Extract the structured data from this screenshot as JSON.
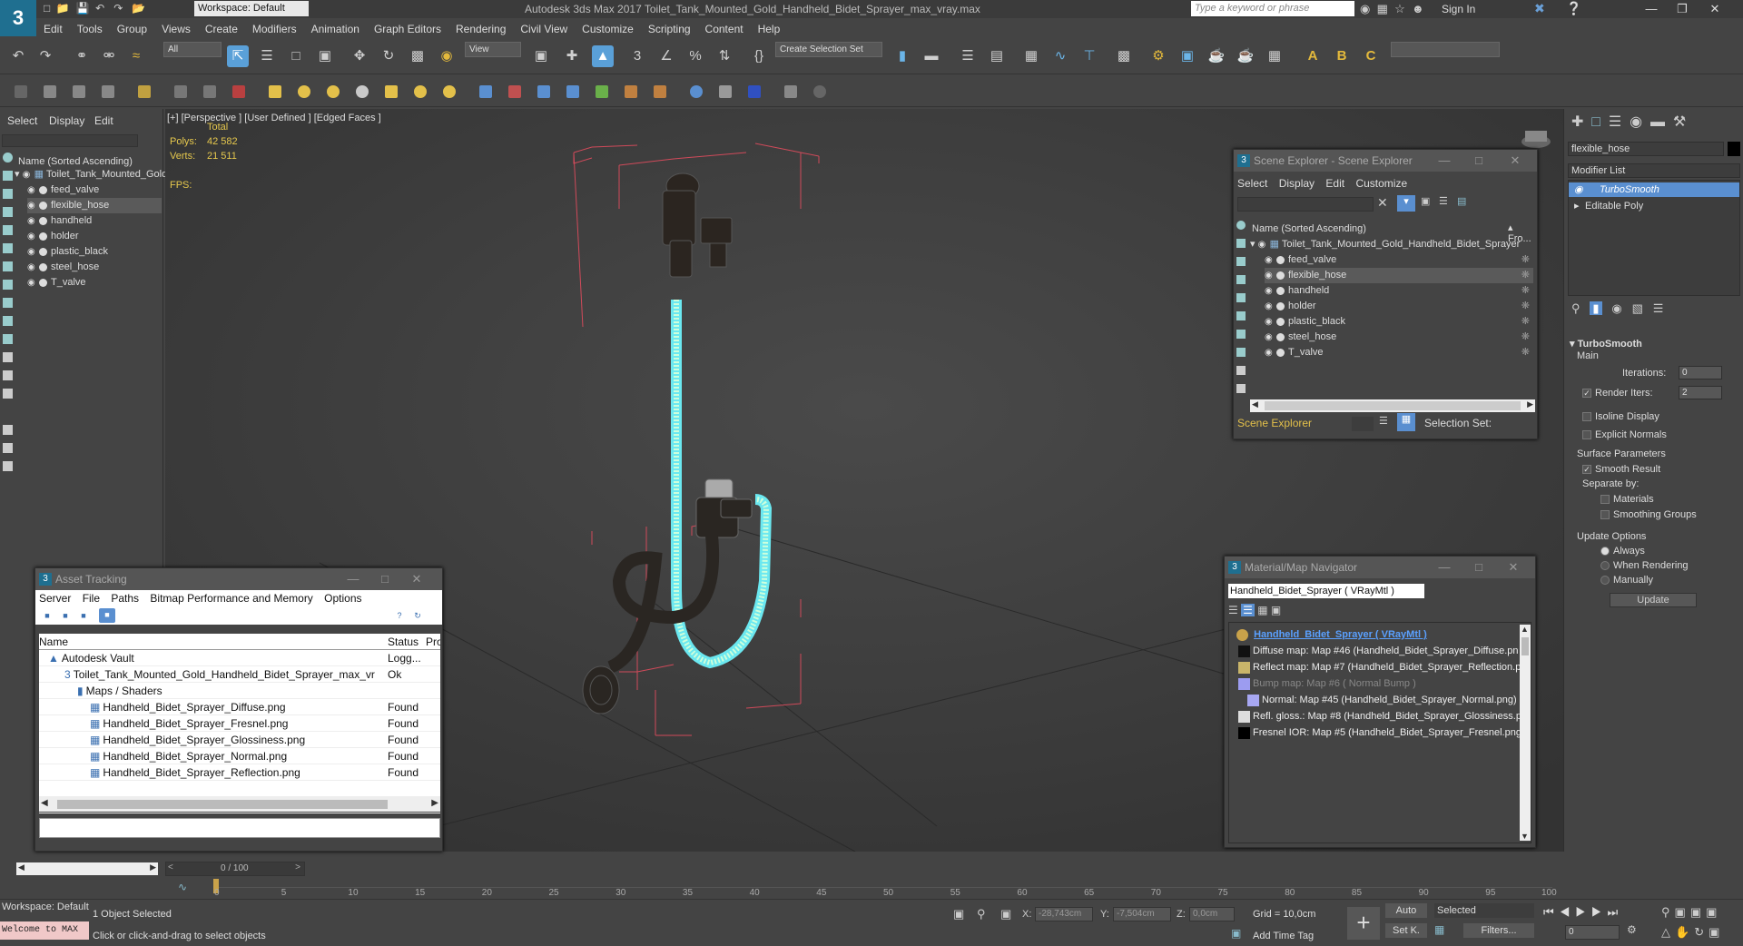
{
  "title_bar": {
    "logo": "3",
    "workspace": "Workspace: Default",
    "app_title": "Autodesk 3ds Max 2017    Toilet_Tank_Mounted_Gold_Handheld_Bidet_Sprayer_max_vray.max",
    "search_placeholder": "Type a keyword or phrase",
    "sign_in": "Sign In"
  },
  "menu": [
    "Edit",
    "Tools",
    "Group",
    "Views",
    "Create",
    "Modifiers",
    "Animation",
    "Graph Editors",
    "Rendering",
    "Civil View",
    "Customize",
    "Scripting",
    "Content",
    "Help"
  ],
  "toolbar": {
    "filter_value": "All",
    "ref_coord": "View",
    "selection_set": "Create Selection Set"
  },
  "left_panel": {
    "menu": [
      "Select",
      "Display",
      "Edit"
    ],
    "header": "Name (Sorted Ascending)",
    "root": "Toilet_Tank_Mounted_Gold",
    "items": [
      "feed_valve",
      "flexible_hose",
      "handheld",
      "holder",
      "plastic_black",
      "steel_hose",
      "T_valve"
    ],
    "selected_index": 1
  },
  "viewport": {
    "label": "[+] [Perspective ] [User Defined ] [Edged Faces ]",
    "total": "Total",
    "polys_label": "Polys:",
    "polys": "42 582",
    "verts_label": "Verts:",
    "verts": "21 511",
    "fps": "FPS:"
  },
  "asset_tracking": {
    "title": "Asset Tracking",
    "menu": [
      "Server",
      "File",
      "Paths",
      "Bitmap Performance and Memory",
      "Options"
    ],
    "columns": [
      "Name",
      "Status",
      "Pro"
    ],
    "rows": [
      {
        "name": "Autodesk Vault",
        "status": "Logg..."
      },
      {
        "name": "Toilet_Tank_Mounted_Gold_Handheld_Bidet_Sprayer_max_vra...",
        "status": "Ok"
      },
      {
        "name": "Maps / Shaders",
        "status": ""
      },
      {
        "name": "Handheld_Bidet_Sprayer_Diffuse.png",
        "status": "Found"
      },
      {
        "name": "Handheld_Bidet_Sprayer_Fresnel.png",
        "status": "Found"
      },
      {
        "name": "Handheld_Bidet_Sprayer_Glossiness.png",
        "status": "Found"
      },
      {
        "name": "Handheld_Bidet_Sprayer_Normal.png",
        "status": "Found"
      },
      {
        "name": "Handheld_Bidet_Sprayer_Reflection.png",
        "status": "Found"
      }
    ]
  },
  "scene_explorer": {
    "title": "Scene Explorer - Scene Explorer",
    "menu": [
      "Select",
      "Display",
      "Edit",
      "Customize"
    ],
    "header": "Name (Sorted Ascending)",
    "header_right": "▴ Fro...",
    "root": "Toilet_Tank_Mounted_Gold_Handheld_Bidet_Sprayer",
    "items": [
      "feed_valve",
      "flexible_hose",
      "handheld",
      "holder",
      "plastic_black",
      "steel_hose",
      "T_valve"
    ],
    "footer_label": "Scene Explorer",
    "selection_set": "Selection Set:"
  },
  "material_navigator": {
    "title": "Material/Map Navigator",
    "field": "Handheld_Bidet_Sprayer  ( VRayMtl )",
    "root": "Handheld_Bidet_Sprayer  ( VRayMtl )",
    "maps": [
      {
        "label": "Diffuse map: Map #46 (Handheld_Bidet_Sprayer_Diffuse.pn",
        "swatch": "#111111",
        "dim": false
      },
      {
        "label": "Reflect map: Map #7 (Handheld_Bidet_Sprayer_Reflection.p",
        "swatch": "#c9b56a",
        "dim": false
      },
      {
        "label": "Bump map: Map #6  ( Normal Bump )",
        "swatch": "#9c9cf0",
        "dim": true
      },
      {
        "label": "Normal: Map #45 (Handheld_Bidet_Sprayer_Normal.png)",
        "swatch": "#a7a7f2",
        "dim": false
      },
      {
        "label": "Refl. gloss.: Map #8 (Handheld_Bidet_Sprayer_Glossiness.pr",
        "swatch": "#dddddd",
        "dim": false
      },
      {
        "label": "Fresnel IOR: Map #5 (Handheld_Bidet_Sprayer_Fresnel.png",
        "swatch": "#000000",
        "dim": false
      }
    ]
  },
  "command_panel": {
    "object_name": "flexible_hose",
    "modifier_list": "Modifier List",
    "stack": [
      "TurboSmooth",
      "Editable Poly"
    ],
    "rollout": "TurboSmooth",
    "main": "Main",
    "iterations_label": "Iterations:",
    "iterations": "0",
    "render_iters_label": "Render Iters:",
    "render_iters": "2",
    "isoline": "Isoline Display",
    "explicit": "Explicit Normals",
    "surface_params": "Surface Parameters",
    "smooth_result": "Smooth Result",
    "separate_by": "Separate by:",
    "materials": "Materials",
    "smoothing_groups": "Smoothing Groups",
    "update_options": "Update Options",
    "always": "Always",
    "when_rendering": "When Rendering",
    "manually": "Manually",
    "update": "Update"
  },
  "timeline": {
    "frame": "0 / 100",
    "ticks": [
      "0",
      "5",
      "10",
      "15",
      "20",
      "25",
      "30",
      "35",
      "40",
      "45",
      "50",
      "55",
      "60",
      "65",
      "70",
      "75",
      "80",
      "85",
      "90",
      "95",
      "100"
    ]
  },
  "status": {
    "workspace": "Workspace: Default",
    "welcome": "Welcome to MAX",
    "selected": "1 Object Selected",
    "hint": "Click or click-and-drag to select objects",
    "x_label": "X:",
    "x": "-28,743cm",
    "y_label": "Y:",
    "y": "-7,504cm",
    "z_label": "Z:",
    "z": "0,0cm",
    "grid": "Grid = 10,0cm",
    "add_time_tag": "Add Time Tag",
    "auto": "Auto",
    "selected_dd": "Selected",
    "setk": "Set K.",
    "filters": "Filters...",
    "frame_field": "0"
  }
}
